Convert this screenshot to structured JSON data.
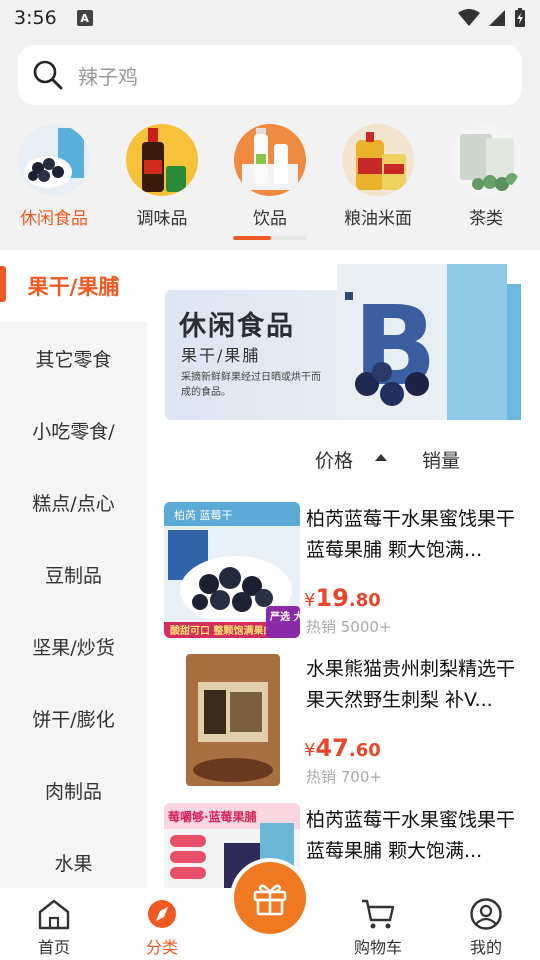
{
  "status": {
    "time": "3:56",
    "a_icon": "A"
  },
  "search": {
    "placeholder": "辣子鸡"
  },
  "top_categories": [
    {
      "label": "休闲食品",
      "active": true
    },
    {
      "label": "调味品",
      "active": false
    },
    {
      "label": "饮品",
      "active": false
    },
    {
      "label": "粮油米面",
      "active": false
    },
    {
      "label": "茶类",
      "active": false
    }
  ],
  "sidebar": [
    "果干/果脯",
    "其它零食",
    "小吃零食/",
    "糕点/点心",
    "豆制品",
    "坚果/炒货",
    "饼干/膨化",
    "肉制品",
    "水果"
  ],
  "banner": {
    "title": "休闲食品",
    "subtitle": "果干/果脯",
    "description": "采摘新鲜鲜果经过日晒或烘干而成的食品。"
  },
  "sort": {
    "price": "价格",
    "sales": "销量"
  },
  "products": [
    {
      "title": "柏芮蓝莓干水果蜜饯果干蓝莓果脯 颗大饱满...",
      "currency": "¥",
      "price_int": "19",
      "price_dec": ".80",
      "sales": "热销 5000+"
    },
    {
      "title": "水果熊猫贵州刺梨精选干果天然野生刺梨 补V...",
      "currency": "¥",
      "price_int": "47",
      "price_dec": ".60",
      "sales": "热销 700+"
    },
    {
      "title": "柏芮蓝莓干水果蜜饯果干蓝莓果脯 颗大饱满...",
      "currency": "¥",
      "price_int": "",
      "price_dec": "",
      "sales": ""
    }
  ],
  "product_image_text": {
    "p1_tag": "柏芮 蓝莓干",
    "p1_badge": "严选 大果",
    "p1_strip": "酸甜可口 整颗饱满果肉",
    "p3_header": "莓嚼够·蓝莓果脯"
  },
  "nav": [
    {
      "label": "首页",
      "active": false
    },
    {
      "label": "分类",
      "active": true
    },
    {
      "label": "购物车",
      "active": false
    },
    {
      "label": "我的",
      "active": false
    }
  ],
  "colors": {
    "accent": "#f05a22",
    "price": "#e8462a",
    "center_button": "#f07a22"
  }
}
